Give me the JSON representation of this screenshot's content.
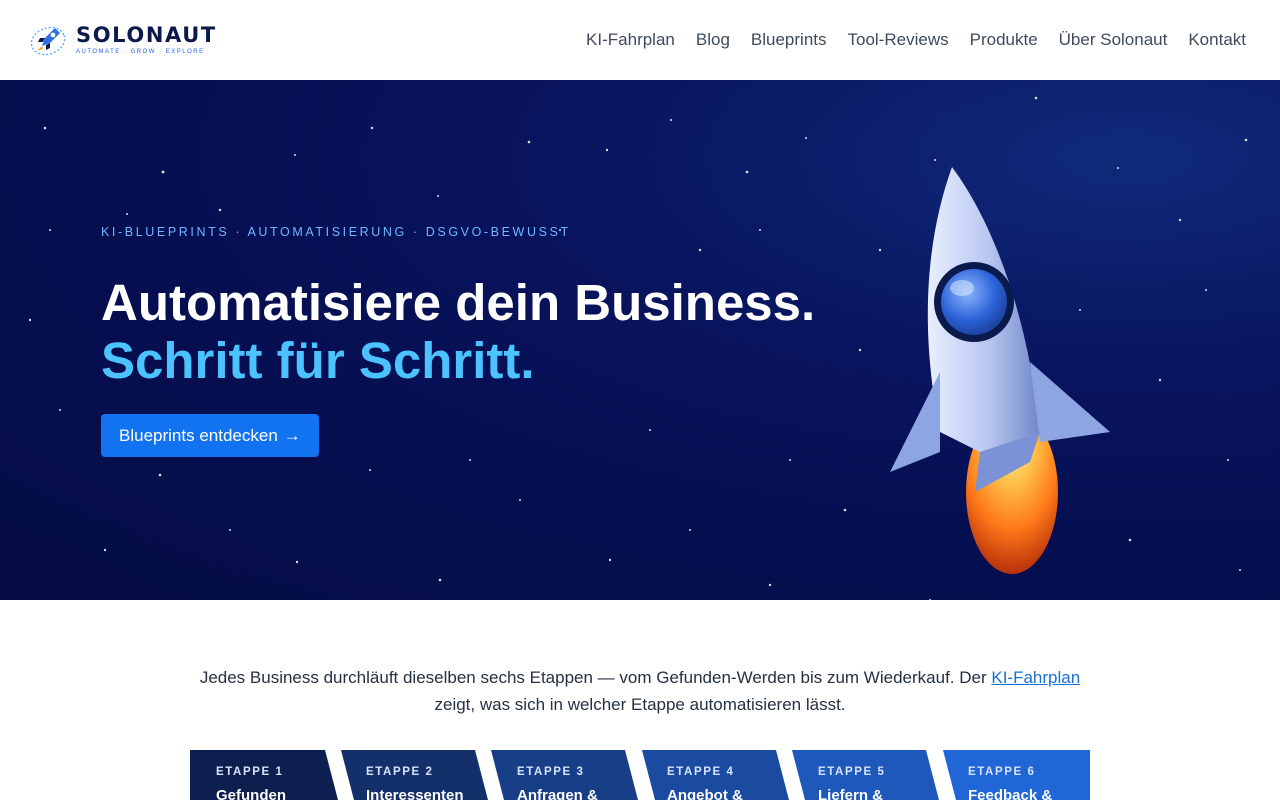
{
  "brand": {
    "name": "SOLONAUT",
    "tagline": "AUTOMATE · GROW · EXPLORE",
    "logo_icon": "rocket-icon"
  },
  "nav": {
    "items": [
      {
        "label": "KI-Fahrplan"
      },
      {
        "label": "Blog"
      },
      {
        "label": "Blueprints"
      },
      {
        "label": "Tool-Reviews"
      },
      {
        "label": "Produkte"
      },
      {
        "label": "Über Solonaut"
      },
      {
        "label": "Kontakt"
      }
    ]
  },
  "hero": {
    "kicker": "KI-BLUEPRINTS · AUTOMATISIERUNG · DSGVO-BEWUSST",
    "title_line1": "Automatisiere dein Business.",
    "title_line2": "Schritt für Schritt.",
    "cta_label": "Blueprints entdecken",
    "cta_arrow": "→",
    "illustration": "rocket-illustration"
  },
  "intro": {
    "text_before": "Jedes Business durchläuft dieselben sechs Etappen — vom Gefunden-Werden bis zum Wiederkauf. Der ",
    "link_label": "KI-Fahrplan",
    "text_after": " zeigt, was sich in welcher Etappe automatisieren lässt."
  },
  "stages": [
    {
      "number": "ETAPPE 1",
      "title": "Gefunden"
    },
    {
      "number": "ETAPPE 2",
      "title": "Interessenten"
    },
    {
      "number": "ETAPPE 3",
      "title": "Anfragen &"
    },
    {
      "number": "ETAPPE 4",
      "title": "Angebot &"
    },
    {
      "number": "ETAPPE 5",
      "title": "Liefern &"
    },
    {
      "number": "ETAPPE 6",
      "title": "Feedback &"
    }
  ],
  "colors": {
    "brand_navy": "#0b1a4a",
    "accent_blue": "#1273f0",
    "hero_accent": "#4cc3ff",
    "stage_colors": [
      "#0d1f4f",
      "#13306b",
      "#173e86",
      "#1b4ba0",
      "#1e58bb",
      "#2166d6"
    ]
  }
}
